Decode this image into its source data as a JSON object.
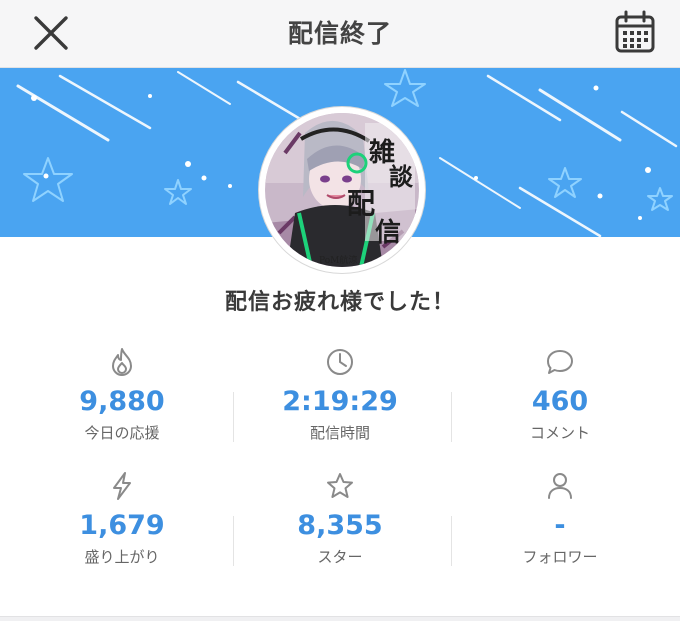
{
  "header": {
    "title": "配信終了",
    "close_icon": "close-icon",
    "calendar_icon": "calendar-icon"
  },
  "banner": {
    "color": "#4aa4f1"
  },
  "avatar": {
    "title_text": "雑談配信",
    "credit_text": "PoM航涼"
  },
  "greeting": "配信お疲れ様でした！",
  "stats": [
    {
      "icon": "flame-icon",
      "value": "9,880",
      "label": "今日の応援"
    },
    {
      "icon": "clock-icon",
      "value": "2:19:29",
      "label": "配信時間"
    },
    {
      "icon": "comment-icon",
      "value": "460",
      "label": "コメント"
    },
    {
      "icon": "lightning-icon",
      "value": "1,679",
      "label": "盛り上がり"
    },
    {
      "icon": "star-icon",
      "value": "8,355",
      "label": "スター"
    },
    {
      "icon": "person-icon",
      "value": "-",
      "label": "フォロワー"
    }
  ],
  "colors": {
    "accent": "#3d8fe0",
    "banner": "#4aa4f1",
    "icon": "#8a8a8a"
  }
}
